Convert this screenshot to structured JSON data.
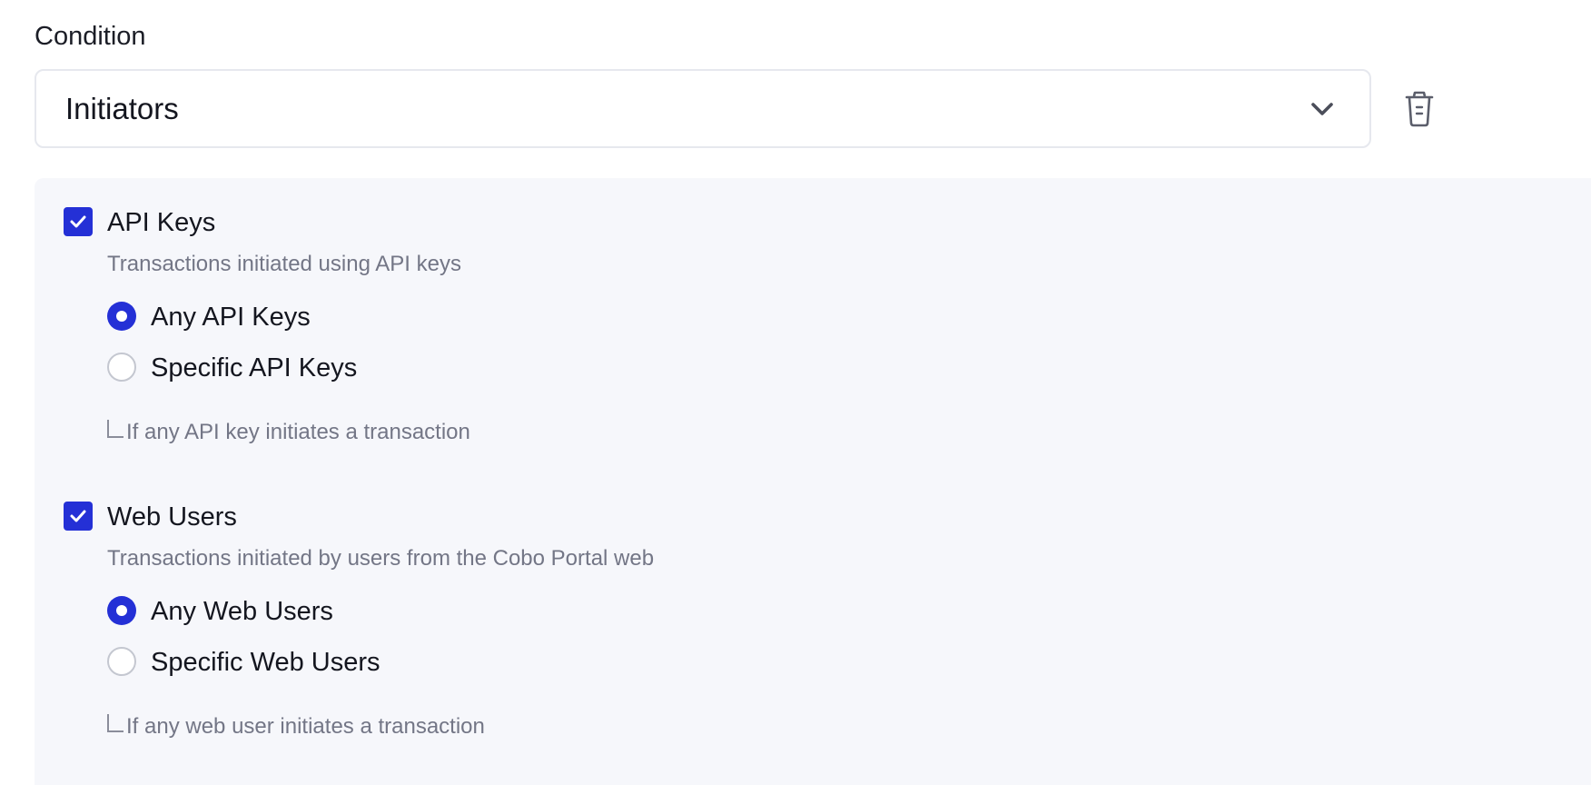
{
  "condition": {
    "label": "Condition",
    "selected": "Initiators",
    "icons": {
      "dropdown": "chevron-down-icon",
      "delete": "trash-icon"
    }
  },
  "groups": [
    {
      "checked": true,
      "title": "API Keys",
      "description": "Transactions initiated using API keys",
      "options": [
        {
          "label": "Any API Keys",
          "selected": true
        },
        {
          "label": "Specific API Keys",
          "selected": false
        }
      ],
      "hint": "If any API key initiates a transaction"
    },
    {
      "checked": true,
      "title": "Web Users",
      "description": "Transactions initiated by users from the Cobo Portal web",
      "options": [
        {
          "label": "Any Web Users",
          "selected": true
        },
        {
          "label": "Specific Web Users",
          "selected": false
        }
      ],
      "hint": "If any web user initiates a transaction"
    }
  ],
  "colors": {
    "accent": "#2430d6",
    "panel_background": "#f6f7fb",
    "muted_text": "#737686",
    "border": "#e6e8ee"
  }
}
